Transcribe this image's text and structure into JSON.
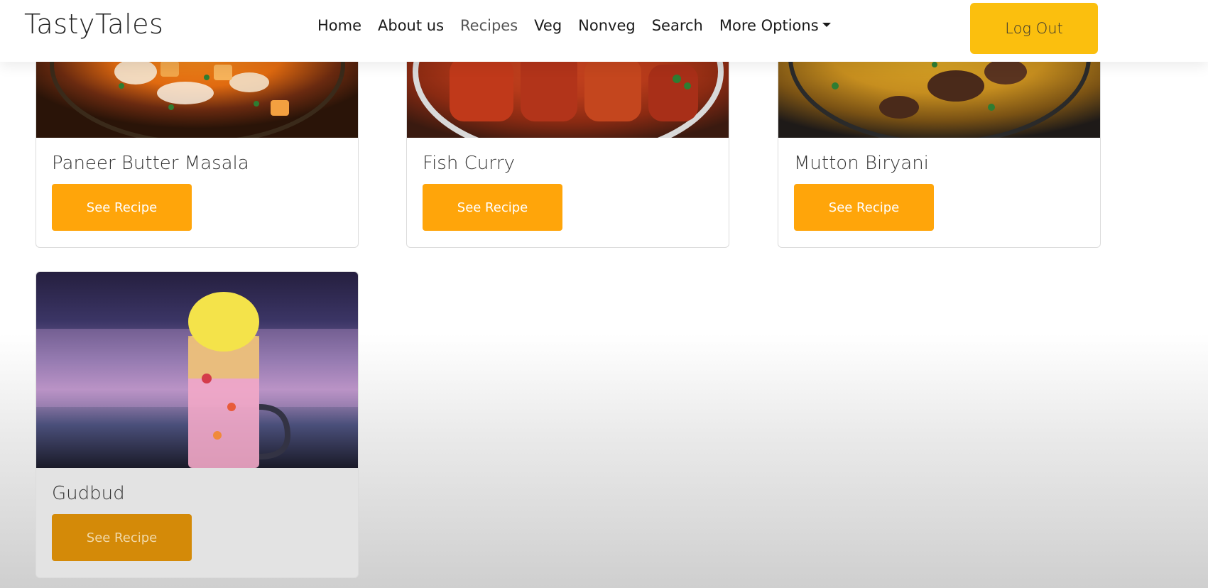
{
  "navbar": {
    "brand": "TastyTales",
    "links": [
      "Home",
      "About us",
      "Recipes",
      "Veg",
      "Nonveg",
      "Search",
      "More Options"
    ],
    "active": "Recipes",
    "logout_label": "Log Out"
  },
  "cards": [
    {
      "title": "Paneer Butter Masala",
      "button": "See Recipe",
      "image": "paneer-butter-masala-image"
    },
    {
      "title": "Fish Curry",
      "button": "See Recipe",
      "image": "fish-curry-image"
    },
    {
      "title": "Mutton Biryani",
      "button": "See Recipe",
      "image": "mutton-biryani-image"
    },
    {
      "title": "Gudbud",
      "button": "See Recipe",
      "image": "gudbud-image"
    }
  ],
  "colors": {
    "accent": "#ffa50a",
    "logout": "#fbbf0e"
  }
}
